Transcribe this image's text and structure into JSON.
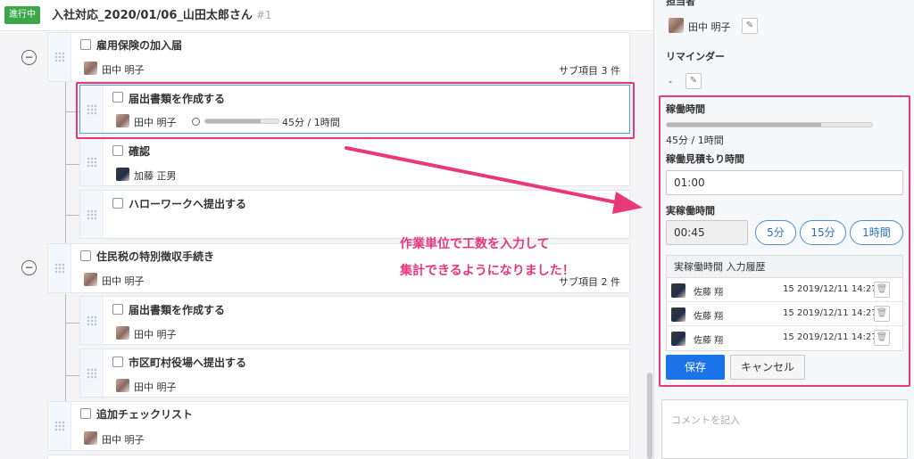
{
  "header": {
    "status": "進行中",
    "title": "入社対応_2020/01/06_山田太郎さん",
    "number": "#1"
  },
  "tasks": {
    "t1": {
      "title": "雇用保険の加入届",
      "assignee": "田中 明子",
      "sub_count": "サブ項目 3 件"
    },
    "t1a": {
      "title": "届出書類を作成する",
      "assignee": "田中 明子",
      "time": "45分 / 1時間",
      "progress": 0.75
    },
    "t1b": {
      "title": "確認",
      "assignee": "加藤 正男"
    },
    "t1c": {
      "title": "ハローワークへ提出する"
    },
    "t2": {
      "title": "住民税の特別徴収手続き",
      "assignee": "田中 明子",
      "sub_count": "サブ項目 2 件"
    },
    "t2a": {
      "title": "届出書類を作成する",
      "assignee": "田中 明子"
    },
    "t2b": {
      "title": "市区町村役場へ提出する",
      "assignee": "田中 明子"
    },
    "t3": {
      "title": "追加チェックリスト",
      "assignee": "田中 明子"
    }
  },
  "annotation": {
    "line1": "作業単位で工数を入力して",
    "line2": "集計できるようになりました！"
  },
  "panel": {
    "assignee_label": "担当者",
    "assignee": "田中 明子",
    "reminder_label": "リマインダー",
    "reminder_value": "-",
    "work_time_label": "稼働時間",
    "work_time_value": "45分 / 1時間",
    "work_progress": 0.75,
    "estimate_label": "稼働見積もり時間",
    "estimate_value": "01:00",
    "actual_label": "実稼働時間",
    "actual_value": "00:45",
    "quick": [
      "5分",
      "15分",
      "1時間"
    ],
    "history_title": "実稼働時間 入力履歴",
    "history": [
      {
        "name": "佐藤 翔",
        "minutes": "15",
        "date": "2019/12/11 14:27"
      },
      {
        "name": "佐藤 翔",
        "minutes": "15",
        "date": "2019/12/11 14:27"
      },
      {
        "name": "佐藤 翔",
        "minutes": "15",
        "date": "2019/12/11 14:27"
      }
    ],
    "save_label": "保存",
    "cancel_label": "キャンセル",
    "comment_placeholder": "コメントを記入"
  },
  "colors": {
    "accent": "#1a73e8",
    "highlight": "#e8387a",
    "status": "#3aa84a"
  }
}
